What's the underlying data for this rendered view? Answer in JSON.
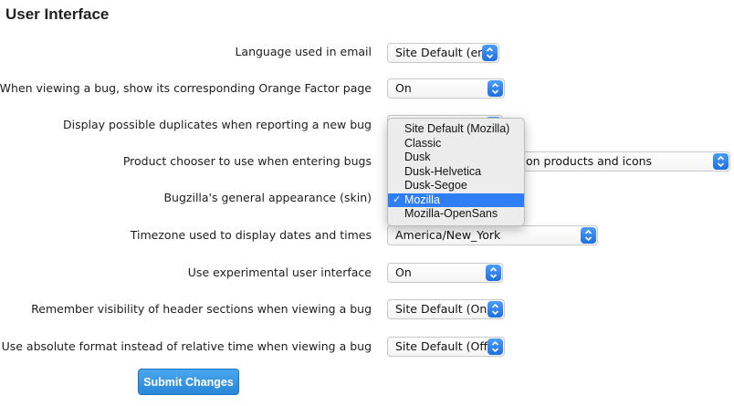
{
  "section": {
    "title": "User Interface"
  },
  "rows": [
    {
      "label": "Language used in email",
      "value": "Site Default (en)"
    },
    {
      "label": "When viewing a bug, show its corresponding Orange Factor page",
      "value": "On"
    },
    {
      "label": "Display possible duplicates when reporting a new bug",
      "value": ""
    },
    {
      "label": "Product chooser to use when entering bugs",
      "value": "on products and icons"
    },
    {
      "label": "Bugzilla's general appearance (skin)",
      "value": "Mozilla"
    },
    {
      "label": "Timezone used to display dates and times",
      "value": "America/New_York"
    },
    {
      "label": "Use experimental user interface",
      "value": "On"
    },
    {
      "label": "Remember visibility of header sections when viewing a bug",
      "value": "Site Default (On)"
    },
    {
      "label": "Use absolute format instead of relative time when viewing a bug",
      "value": "Site Default (Off)"
    }
  ],
  "skin_dropdown": {
    "options": [
      "Site Default (Mozilla)",
      "Classic",
      "Dusk",
      "Dusk-Helvetica",
      "Dusk-Segoe",
      "Mozilla",
      "Mozilla-OpenSans"
    ],
    "selected": "Mozilla",
    "check_glyph": "✓",
    "highlight_color": "#2f7ef5"
  },
  "submit": {
    "label": "Submit Changes"
  },
  "colors": {
    "accent": "#2f7ef5",
    "button": "#3a97e4"
  },
  "icons": {
    "stepper": "up-down-chevron-icon",
    "check": "checkmark-icon"
  }
}
